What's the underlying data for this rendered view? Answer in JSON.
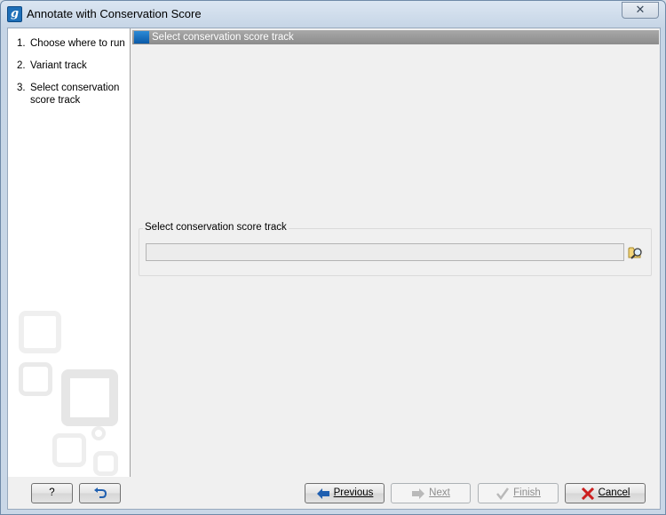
{
  "window": {
    "title": "Annotate with Conservation Score",
    "close_glyph": "✕",
    "app_icon_glyph": "g"
  },
  "steps": [
    {
      "num": "1.",
      "label": "Choose where to run"
    },
    {
      "num": "2.",
      "label": "Variant track"
    },
    {
      "num": "3.",
      "label": "Select conservation score track"
    }
  ],
  "main": {
    "section_title": "Select conservation score track",
    "group_label": "Select conservation score track",
    "track_value": ""
  },
  "buttons": {
    "help": "?",
    "previous": "Previous",
    "next": "Next",
    "finish": "Finish",
    "cancel": "Cancel"
  },
  "colors": {
    "accent": "#1e6fb8",
    "section_header": "#999999",
    "arrow_blue": "#1f5fb0",
    "cancel_x": "#cc1f1f"
  }
}
